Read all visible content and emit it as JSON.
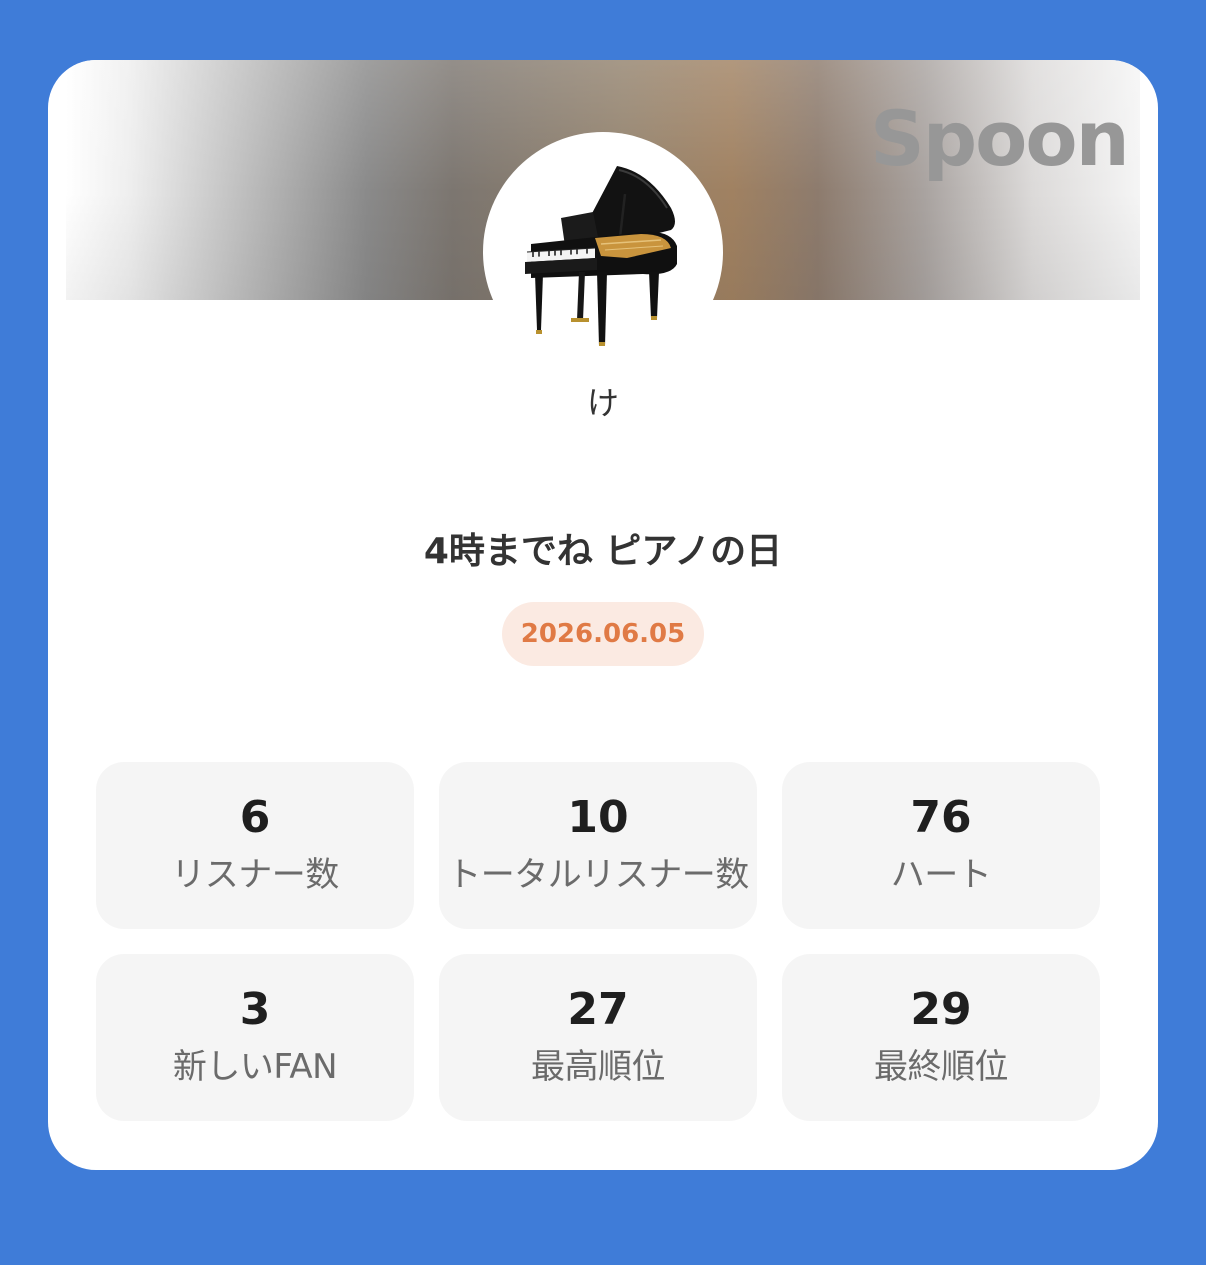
{
  "brand": {
    "logo_text": "Spoon"
  },
  "profile": {
    "username": "け",
    "avatar_icon": "grand-piano-icon"
  },
  "broadcast": {
    "title": "4時までね ピアノの日",
    "date": "2026.06.05"
  },
  "colors": {
    "background": "#3f7cd8",
    "date_text": "#e07a45",
    "date_pill": "#fbeae2",
    "stat_card": "#f5f5f5"
  },
  "stats": [
    {
      "value": "6",
      "label": "リスナー数"
    },
    {
      "value": "10",
      "label": "トータルリスナー数"
    },
    {
      "value": "76",
      "label": "ハート"
    },
    {
      "value": "3",
      "label": "新しいFAN"
    },
    {
      "value": "27",
      "label": "最高順位"
    },
    {
      "value": "29",
      "label": "最終順位"
    }
  ]
}
